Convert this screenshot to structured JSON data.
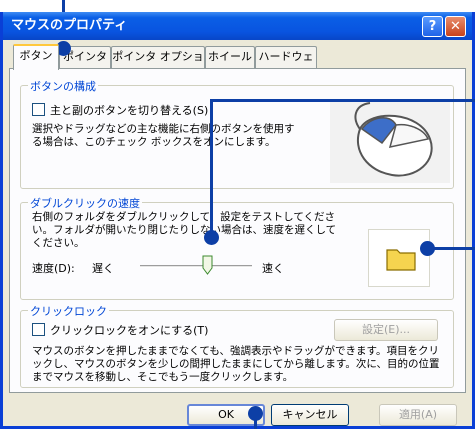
{
  "window": {
    "title": "マウスのプロパティ",
    "help": "?",
    "close": "✕"
  },
  "tabs": [
    {
      "label": "ボタン"
    },
    {
      "label": "ポインタ"
    },
    {
      "label": "ポインタ オプション"
    },
    {
      "label": "ホイール"
    },
    {
      "label": "ハードウェア"
    }
  ],
  "button_config": {
    "title": "ボタンの構成",
    "checkbox_label": "主と副のボタンを切り替える(S)",
    "description": "選択やドラッグなどの主な機能に右側のボタンを使用する場合は、このチェック ボックスをオンにします。"
  },
  "double_click": {
    "title": "ダブルクリックの速度",
    "description": "右側のフォルダをダブルクリックして、設定をテストしてください。フォルダが開いたり閉じたりしない場合は、速度を遅くしてください。",
    "speed_label": "速度(D):",
    "slow": "遅く",
    "fast": "速く",
    "speed_level": 0.5
  },
  "click_lock": {
    "title": "クリックロック",
    "checkbox_label": "クリックロックをオンにする(T)",
    "settings_button": "設定(E)...",
    "description": "マウスのボタンを押したままでなくても、強調表示やドラッグができます。項目をクリックし、マウスのボタンを少しの間押したままにしてから離します。次に、目的の位置までマウスを移動し、そこでもう一度クリックします。"
  },
  "buttons": {
    "ok": "OK",
    "cancel": "キャンセル",
    "apply": "適用(A)"
  },
  "colors": {
    "titlebar": "#0a5fe6",
    "callout": "#0d3fa6",
    "group_title": "#0046d5"
  }
}
